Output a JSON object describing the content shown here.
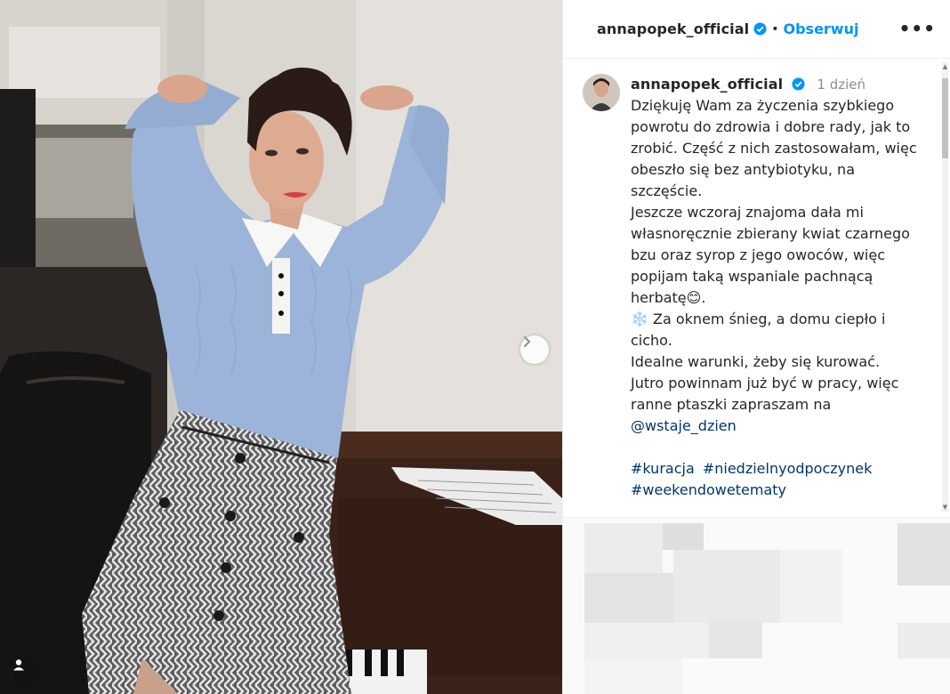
{
  "post": {
    "username": "annapopek_official",
    "separator": "•",
    "follow_label": "Obserwuj",
    "more_label": "•••"
  },
  "caption": {
    "username": "annapopek_official",
    "time": "1 dzień",
    "lines_1": "Dziękuję Wam za życzenia szybkiego powrotu do zdrowia i dobre rady, jak to zrobić. Część z nich zastosowałam, więc obeszło się bez antybiotyku, na szczęście.\nJeszcze wczoraj znajoma dała mi własnoręcznie zbierany kwiat czarnego bzu oraz syrop z jego owoców, więc popijam taką wspaniale pachnącą herbatę",
    "emoji_smile": "😊",
    "after_smile": ".",
    "emoji_snow": "❄️",
    "lines_2": "Za oknem śnieg, a domu ciepło i cicho.\nIdealne warunki, żeby się kurować.\nJutro powinnam już być w pracy, więc ranne ptaszki zapraszam na",
    "mention": "@wstaje_dzien",
    "hashtags": [
      "#kuracja",
      "#niedzielnyodpoczynek",
      "#weekendowetematy"
    ]
  },
  "colors": {
    "accent": "#0095f6",
    "link": "#00376b",
    "muted": "#8e8e8e",
    "text": "#262626"
  },
  "icons": {
    "verified": "verified-badge-icon",
    "next": "chevron-right-icon",
    "tag": "user-tag-icon",
    "more": "more-options-icon"
  }
}
